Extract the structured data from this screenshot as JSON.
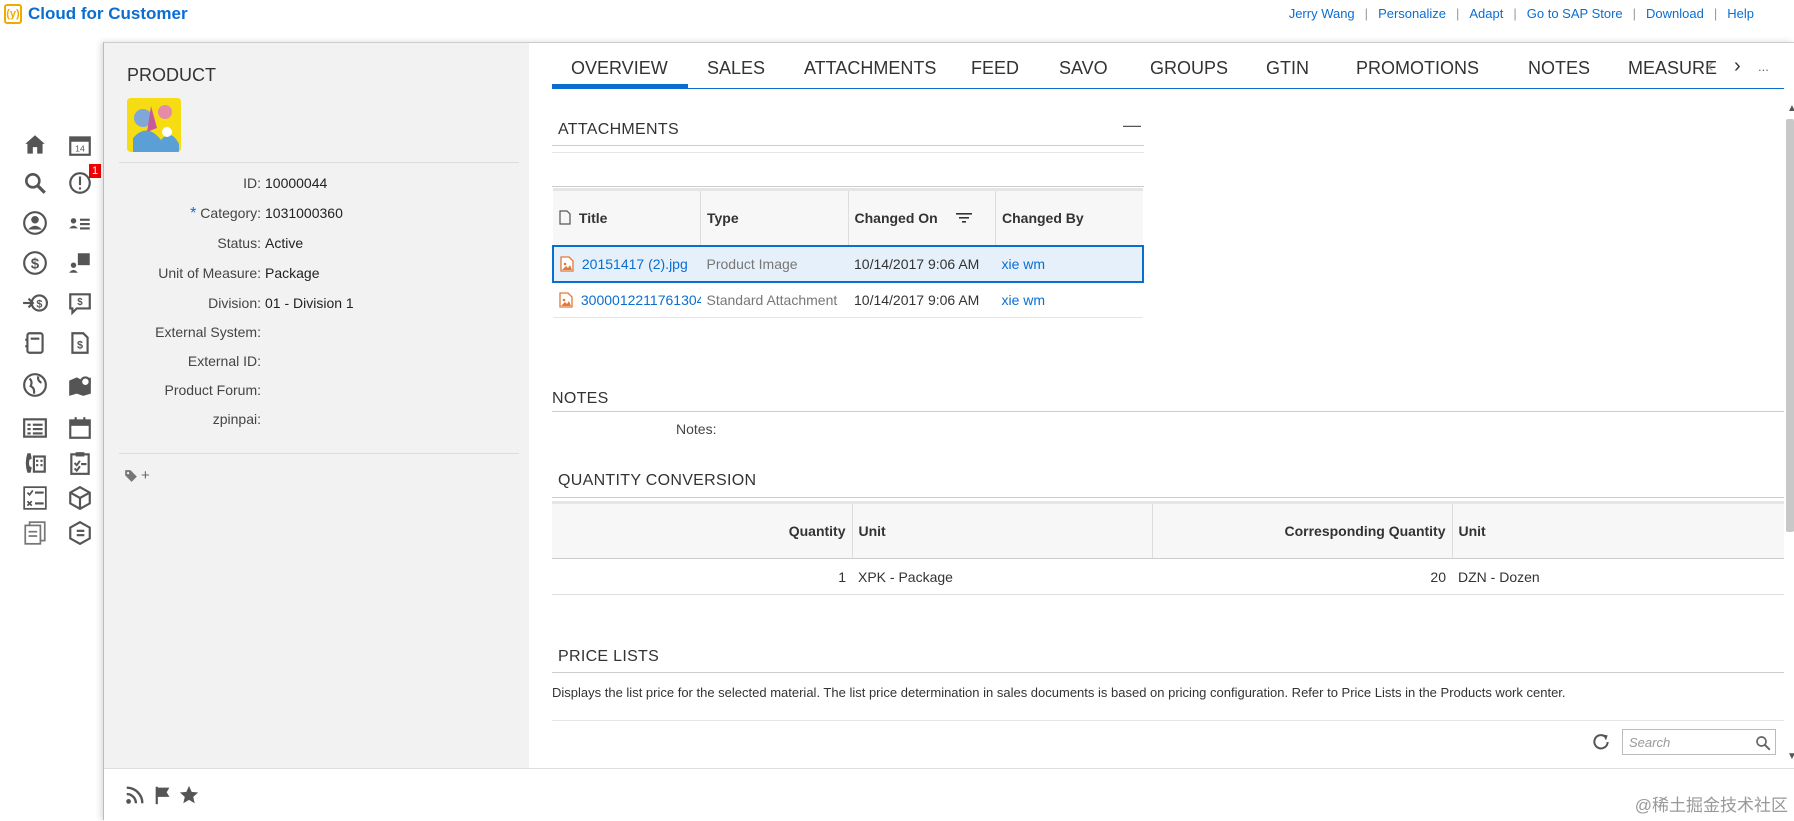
{
  "brand": {
    "logo": "(y)",
    "name": "Cloud for Customer"
  },
  "toplinks": [
    "Jerry Wang",
    "Personalize",
    "Adapt",
    "Go to SAP Store",
    "Download",
    "Help"
  ],
  "nav": {
    "badge_count": "1"
  },
  "product": {
    "title": "PRODUCT",
    "fields": [
      {
        "label": "ID:",
        "value": "10000044",
        "required": false
      },
      {
        "label": "Category:",
        "value": "1031000360",
        "required": true
      },
      {
        "label": "Status:",
        "value": "Active",
        "required": false
      },
      {
        "label": "Unit of Measure:",
        "value": "Package",
        "required": false
      },
      {
        "label": "Division:",
        "value": "01 - Division 1",
        "required": false
      },
      {
        "label": "External System:",
        "value": "",
        "required": false
      },
      {
        "label": "External ID:",
        "value": "",
        "required": false
      },
      {
        "label": "Product Forum:",
        "value": "",
        "required": false
      },
      {
        "label": "zpinpai:",
        "value": "",
        "required": false
      }
    ],
    "tag_add": "+"
  },
  "tabs": [
    "OVERVIEW",
    "SALES",
    "ATTACHMENTS",
    "FEED",
    "SAVO",
    "GROUPS",
    "GTIN",
    "PROMOTIONS",
    "NOTES",
    "MEASURE"
  ],
  "more_label": "...",
  "attachments": {
    "title": "ATTACHMENTS",
    "collapse": "—",
    "columns": [
      "Title",
      "Type",
      "Changed On",
      "Changed By"
    ],
    "rows": [
      {
        "title": "20151417 (2).jpg",
        "type": "Product Image",
        "changed_on": "10/14/2017 9:06 AM",
        "changed_by": "xie wm"
      },
      {
        "title": "3000012211761304...",
        "type": "Standard Attachment",
        "changed_on": "10/14/2017 9:06 AM",
        "changed_by": "xie wm"
      }
    ]
  },
  "notes": {
    "title": "NOTES",
    "label": "Notes:"
  },
  "quantity_conversion": {
    "title": "QUANTITY CONVERSION",
    "columns": [
      "Quantity",
      "Unit",
      "Corresponding Quantity",
      "Unit"
    ],
    "rows": [
      {
        "quantity": "1",
        "unit": "XPK - Package",
        "corr_quantity": "20",
        "corr_unit": "DZN - Dozen"
      }
    ]
  },
  "price_lists": {
    "title": "PRICE LISTS",
    "description": "Displays the list price for the selected material. The list price determination in sales documents is based on pricing configuration. Refer to Price Lists in the Products work center.",
    "search_placeholder": "Search"
  },
  "watermark": "@稀土掘金技术社区",
  "colors": {
    "accent": "#0a6ed1",
    "brand_yellow": "#f0ab00",
    "badge_red": "#e00000"
  }
}
